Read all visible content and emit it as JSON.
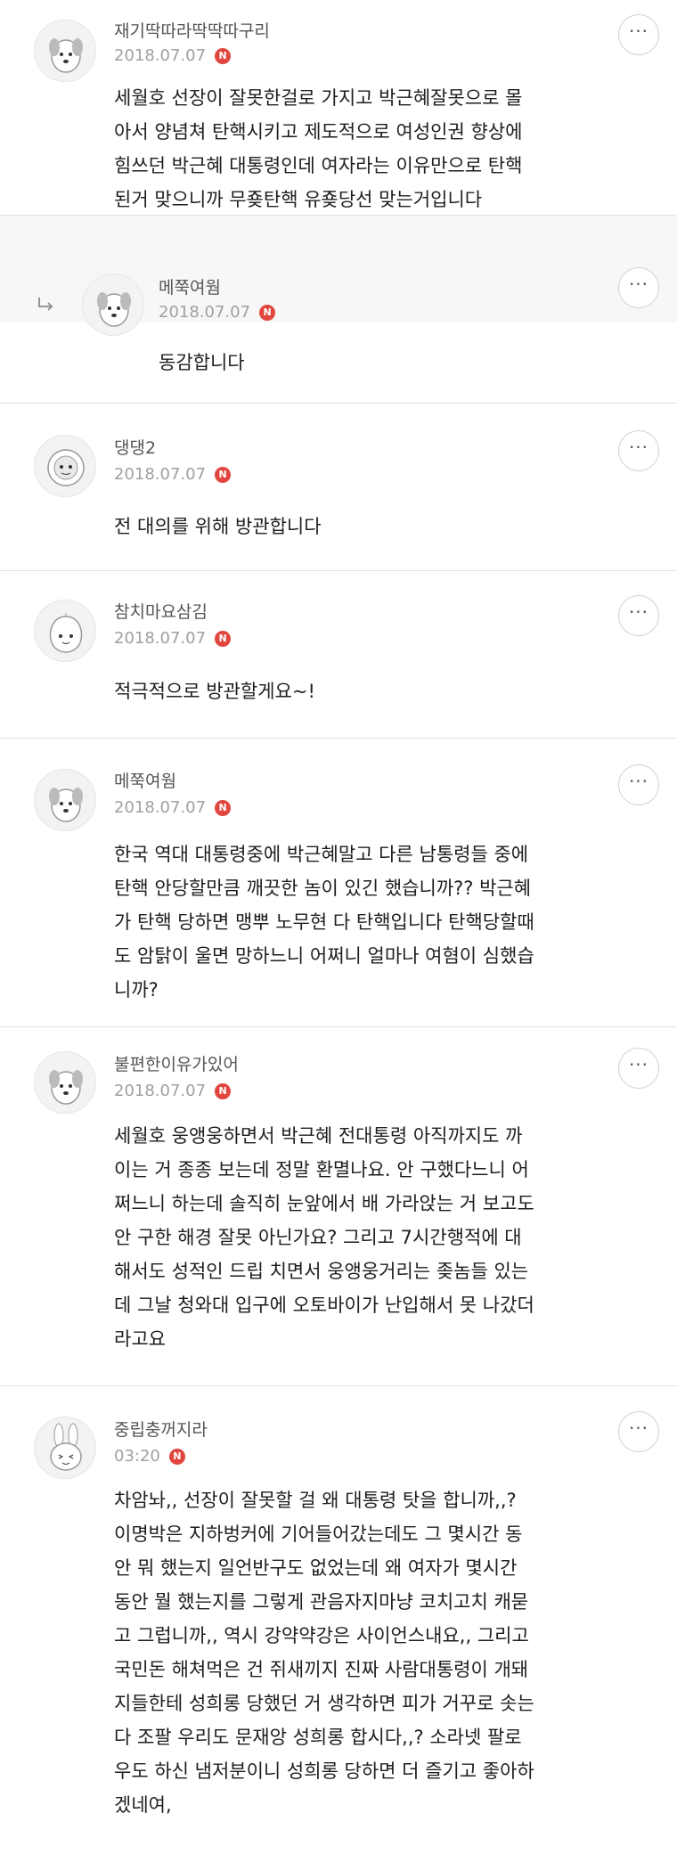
{
  "ui": {
    "more_icon": "more-dots-icon",
    "new_badge": "N",
    "reply_arrow_icon": "reply-arrow-icon"
  },
  "comments": [
    {
      "nickname": "재기딱따라딱딱따구리",
      "date": "2018.07.07",
      "avatar_icon": "dog-character-avatar-icon",
      "lines": [
        "세월호 선장이 잘못한걸로 가지고 박근혜잘못으로 몰",
        "아서 양념쳐 탄핵시키고 제도적으로 여성인권 향상에",
        "힘쓰던 박근혜 대통령인데 여자라는 이유만으로 탄핵",
        "된거 맞으니까 무죶탄핵 유죶당선 맞는거입니다"
      ]
    },
    {
      "nickname": "메쭉여웜",
      "date": "2018.07.07",
      "avatar_icon": "dog-character-avatar-icon",
      "reply": true,
      "lines": [
        "동감합니다"
      ]
    },
    {
      "nickname": "댕댕2",
      "date": "2018.07.07",
      "avatar_icon": "astronaut-character-avatar-icon",
      "lines": [
        "전 대의를 위해 방관합니다"
      ]
    },
    {
      "nickname": "참치마요삼김",
      "date": "2018.07.07",
      "avatar_icon": "peach-character-avatar-icon",
      "lines": [
        "적극적으로 방관할게요~!"
      ]
    },
    {
      "nickname": "메쭉여웜",
      "date": "2018.07.07",
      "avatar_icon": "dog-character-avatar-icon",
      "lines": [
        "한국 역대 대통령중에 박근혜말고 다른 남통령들 중에",
        "탄핵 안당할만큼 깨끗한 놈이 있긴 했습니까?? 박근혜",
        "가 탄핵 당하면 맹뿌 노무현 다 탄핵입니다 탄핵당할때",
        "도 암탉이 울면 망하느니 어쩌니 얼마나 여혐이 심했습",
        "니까?"
      ]
    },
    {
      "nickname": "불편한이유가있어",
      "date": "2018.07.07",
      "avatar_icon": "dog-character-avatar-icon",
      "lines": [
        "세월호 웅앵웅하면서 박근혜 전대통령 아직까지도 까",
        "이는 거 종종 보는데 정말 환멸나요. 안 구했다느니 어",
        "쩌느니 하는데 솔직히 눈앞에서 배 가라앉는 거 보고도",
        "안 구한 해경 잘못 아닌가요? 그리고 7시간행적에 대",
        "해서도 성적인 드립 치면서 웅앵웅거리는 좆놈들 있는",
        "데 그날 청와대 입구에 오토바이가 난입해서 못 나갔더",
        "라고요"
      ]
    },
    {
      "nickname": "중립충꺼지라",
      "date": "03:20",
      "avatar_icon": "rabbit-character-avatar-icon",
      "lines": [
        "차암놔,, 선장이 잘못할 걸 왜 대통령 탓을 합니까,,?",
        "이명박은 지하벙커에 기어들어갔는데도 그 몇시간 동",
        "안 뭐 했는지 일언반구도 없었는데 왜 여자가 몇시간",
        "동안 뭘 했는지를 그렇게 관음자지마냥 코치고치 캐묻",
        "고 그럽니까,, 역시 강약약강은 사이언스내요,, 그리고",
        "국민돈 해쳐먹은 건 쥐새끼지 진짜 사람대통령이 개돼",
        "지들한테 성희롱 당했던 거 생각하면 피가 거꾸로 솟는",
        "다 조팔 우리도 문재앙 성희롱 합시다,,? 소라넷 팔로",
        "우도 하신 냄저분이니 성희롱 당하면 더 즐기고 좋아하",
        "겠네여,"
      ]
    }
  ]
}
